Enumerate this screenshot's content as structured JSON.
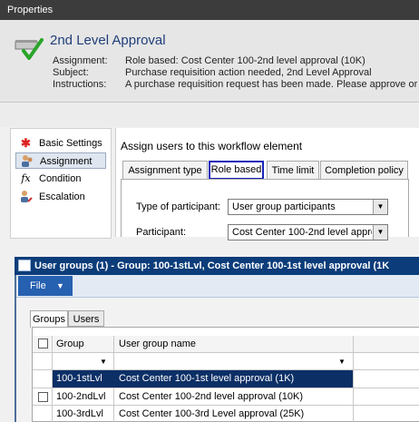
{
  "properties_window": {
    "title": "Properties",
    "header_title": "2nd Level Approval",
    "fields": [
      {
        "label": "Assignment:",
        "value": "Role based: Cost Center 100-2nd level approval (10K)"
      },
      {
        "label": "Subject:",
        "value": "Purchase requisition action needed, 2nd Level Approval"
      },
      {
        "label": "Instructions:",
        "value": "A purchase requisition request has been made.  Please approve or"
      }
    ]
  },
  "nav": {
    "items": [
      {
        "label": "Basic Settings",
        "icon": "asterisk-icon"
      },
      {
        "label": "Assignment",
        "icon": "users-icon"
      },
      {
        "label": "Condition",
        "icon": "fx-icon"
      },
      {
        "label": "Escalation",
        "icon": "escalation-icon"
      }
    ],
    "selected": "Assignment"
  },
  "assignment": {
    "heading": "Assign users to this workflow element",
    "tabs": [
      "Assignment type",
      "Role based",
      "Time limit",
      "Completion policy"
    ],
    "active_tab": "Role based",
    "type_of_participant_label": "Type of participant:",
    "type_of_participant_value": "User group participants",
    "participant_label": "Participant:",
    "participant_value": "Cost Center 100-2nd level appro"
  },
  "user_groups_window": {
    "title": "User groups (1) - Group: 100-1stLvl, Cost Center 100-1st level approval (1K",
    "file_label": "File",
    "tabs": [
      "Groups",
      "Users"
    ],
    "active_tab": "Groups",
    "columns": [
      "Group",
      "User group name"
    ],
    "rows": [
      {
        "group": "100-1stLvl",
        "name": "Cost Center 100-1st level approval (1K)",
        "selected": true
      },
      {
        "group": "100-2ndLvl",
        "name": "Cost Center 100-2nd level approval (10K)",
        "selected": false
      },
      {
        "group": "100-3rdLvl",
        "name": "Cost Center 100-3rd Level approval (25K)",
        "selected": false
      }
    ]
  },
  "colors": {
    "title_bar": "#0c3d7a",
    "selected_row": "#0c2f66",
    "active_tab_border": "#1a22b8",
    "header_title": "#1f3f7a"
  }
}
